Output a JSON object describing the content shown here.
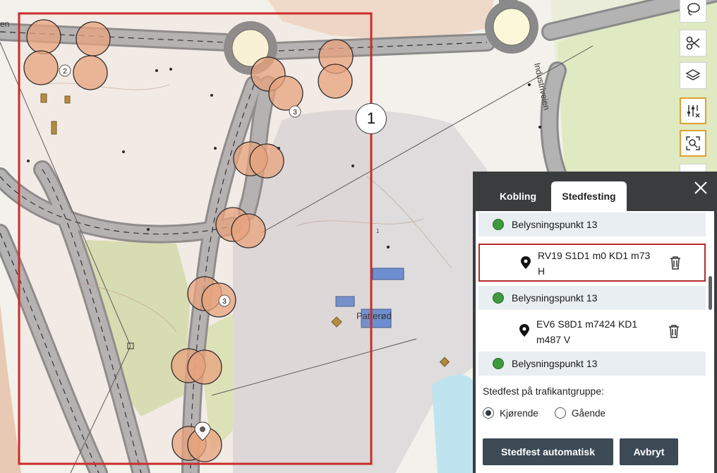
{
  "map": {
    "street_label": "Industriveien",
    "place_label": "Patterød",
    "left_edge_label": "en",
    "cluster_labels": [
      "2",
      "3",
      "3"
    ],
    "small_label": "1",
    "selection_color": "#cc2b2b",
    "light_color": "#e8a37a"
  },
  "callouts": [
    "1",
    "2"
  ],
  "toolbar": {
    "icons": [
      "lasso-icon",
      "scissors-icon",
      "layers-icon",
      "sliders-icon",
      "zoom-to-selection-icon"
    ]
  },
  "panel": {
    "tabs": [
      "Kobling",
      "Stedfesting"
    ],
    "active_tab": "Stedfesting",
    "items": [
      {
        "kind": "point",
        "label": "Belysningspunkt 13"
      },
      {
        "kind": "location",
        "label": "RV19 S1D1 m0 KD1 m73 H",
        "highlighted": true
      },
      {
        "kind": "point",
        "label": "Belysningspunkt 13"
      },
      {
        "kind": "location",
        "label": "EV6 S8D1 m7424 KD1 m487 V"
      },
      {
        "kind": "point",
        "label": "Belysningspunkt 13"
      }
    ],
    "group_label": "Stedfest på trafikantgruppe:",
    "options": [
      {
        "label": "Kjørende",
        "selected": true
      },
      {
        "label": "Gående",
        "selected": false
      }
    ],
    "auto_button": "Stedfest automatisk",
    "cancel_button": "Avbryt"
  }
}
